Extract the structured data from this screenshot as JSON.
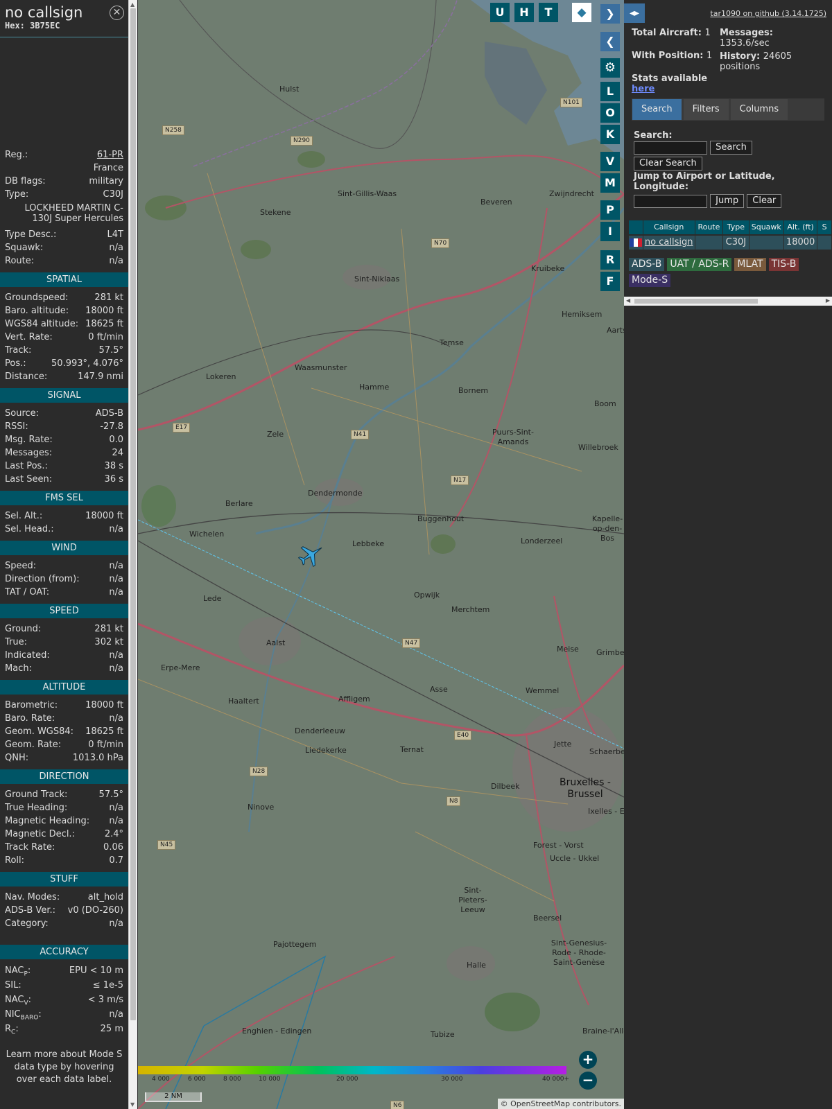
{
  "info": {
    "callsign": "no callsign",
    "hex": "Hex: 3B75EC",
    "reg_label": "Reg.:",
    "reg": "61-PR",
    "country": "France",
    "dbflags_label": "DB flags:",
    "dbflags": "military",
    "type_label": "Type:",
    "type": "C30J",
    "type_long": "LOCKHEED MARTIN C-130J Super Hercules",
    "typedesc_label": "Type Desc.:",
    "typedesc": "L4T",
    "squawk_label": "Squawk:",
    "squawk": "n/a",
    "route_label": "Route:",
    "route": "n/a",
    "sections": {
      "spatial": "SPATIAL",
      "signal": "SIGNAL",
      "fms": "FMS SEL",
      "wind": "WIND",
      "speed": "SPEED",
      "altitude": "ALTITUDE",
      "direction": "DIRECTION",
      "stuff": "STUFF",
      "accuracy": "ACCURACY"
    },
    "spatial": [
      {
        "k": "Groundspeed:",
        "v": "281 kt"
      },
      {
        "k": "Baro. altitude:",
        "v": "18000 ft"
      },
      {
        "k": "WGS84 altitude:",
        "v": "18625 ft"
      },
      {
        "k": "Vert. Rate:",
        "v": "0 ft/min"
      },
      {
        "k": "Track:",
        "v": "57.5°"
      },
      {
        "k": "Pos.:",
        "v": "50.993°, 4.076°"
      },
      {
        "k": "Distance:",
        "v": "147.9 nmi"
      }
    ],
    "signal": [
      {
        "k": "Source:",
        "v": "ADS-B"
      },
      {
        "k": "RSSI:",
        "v": "-27.8"
      },
      {
        "k": "Msg. Rate:",
        "v": "0.0"
      },
      {
        "k": "Messages:",
        "v": "24"
      },
      {
        "k": "Last Pos.:",
        "v": "38 s"
      },
      {
        "k": "Last Seen:",
        "v": "36 s"
      }
    ],
    "fms": [
      {
        "k": "Sel. Alt.:",
        "v": "18000 ft"
      },
      {
        "k": "Sel. Head.:",
        "v": "n/a"
      }
    ],
    "wind": [
      {
        "k": "Speed:",
        "v": "n/a"
      },
      {
        "k": "Direction (from):",
        "v": "n/a"
      },
      {
        "k": "TAT / OAT:",
        "v": "n/a"
      }
    ],
    "speed": [
      {
        "k": "Ground:",
        "v": "281 kt"
      },
      {
        "k": "True:",
        "v": "302 kt"
      },
      {
        "k": "Indicated:",
        "v": "n/a"
      },
      {
        "k": "Mach:",
        "v": "n/a"
      }
    ],
    "altitude": [
      {
        "k": "Barometric:",
        "v": "18000 ft"
      },
      {
        "k": "Baro. Rate:",
        "v": "n/a"
      },
      {
        "k": "Geom. WGS84:",
        "v": "18625 ft"
      },
      {
        "k": "Geom. Rate:",
        "v": "0 ft/min"
      },
      {
        "k": "QNH:",
        "v": "1013.0 hPa"
      }
    ],
    "direction": [
      {
        "k": "Ground Track:",
        "v": "57.5°"
      },
      {
        "k": "True Heading:",
        "v": "n/a"
      },
      {
        "k": "Magnetic Heading:",
        "v": "n/a"
      },
      {
        "k": "Magnetic Decl.:",
        "v": "2.4°"
      },
      {
        "k": "Track Rate:",
        "v": "0.06"
      },
      {
        "k": "Roll:",
        "v": "0.7"
      }
    ],
    "stuff": [
      {
        "k": "Nav. Modes:",
        "v": "alt_hold"
      },
      {
        "k": "ADS-B Ver.:",
        "v": "v0 (DO-260)"
      },
      {
        "k": "Category:",
        "v": "n/a"
      }
    ],
    "accuracy": {
      "nacp_k": "NAC",
      "nacp_sub": "P",
      "nacp_v": "EPU < 10 m",
      "sil_k": "SIL:",
      "sil_v": "≤ 1e-5",
      "nacv_k": "NAC",
      "nacv_sub": "V",
      "nacv_v": "< 3 m/s",
      "nic_k": "NIC",
      "nic_sub": "BARO",
      "nic_v": "n/a",
      "rc_k": "R",
      "rc_sub": "C",
      "rc_v": "25 m"
    },
    "learn_more": "Learn more about Mode S data type by hovering over each data label."
  },
  "map": {
    "buttons": [
      "U",
      "H",
      "T"
    ],
    "side_buttons": [
      "L",
      "O",
      "K",
      "V",
      "M",
      "P",
      "I",
      "R",
      "F"
    ],
    "places": [
      {
        "name": "Hulst"
      },
      {
        "name": "Stekene"
      },
      {
        "name": "Sint-Gillis-Waas"
      },
      {
        "name": "Beveren"
      },
      {
        "name": "Zwijndrecht"
      },
      {
        "name": "Kruibeke"
      },
      {
        "name": "Hemiksem"
      },
      {
        "name": "Sint-Niklaas"
      },
      {
        "name": "Temse"
      },
      {
        "name": "Lokeren"
      },
      {
        "name": "Waasmunster"
      },
      {
        "name": "Hamme"
      },
      {
        "name": "Bornem"
      },
      {
        "name": "Boom"
      },
      {
        "name": "Zele"
      },
      {
        "name": "Puurs-Sint-Amands"
      },
      {
        "name": "Willebroek"
      },
      {
        "name": "Berlare"
      },
      {
        "name": "Dendermonde"
      },
      {
        "name": "Buggenhout"
      },
      {
        "name": "Kapelle-op-den-Bos"
      },
      {
        "name": "Wichelen"
      },
      {
        "name": "Lebbeke"
      },
      {
        "name": "Londerzeel"
      },
      {
        "name": "Lede"
      },
      {
        "name": "Opwijk"
      },
      {
        "name": "Merchtem"
      },
      {
        "name": "Aalst"
      },
      {
        "name": "Meise"
      },
      {
        "name": "Grimberg"
      },
      {
        "name": "Erpe-Mere"
      },
      {
        "name": "Asse"
      },
      {
        "name": "Wemmel"
      },
      {
        "name": "Haaltert"
      },
      {
        "name": "Affligem"
      },
      {
        "name": "Denderleeuw"
      },
      {
        "name": "Ternat"
      },
      {
        "name": "Jette"
      },
      {
        "name": "Liedekerke"
      },
      {
        "name": "Dilbeek"
      },
      {
        "name": "Bruxelles - Brussel"
      },
      {
        "name": "Ninove"
      },
      {
        "name": "Forest - Vorst"
      },
      {
        "name": "Uccle - Ukkel"
      },
      {
        "name": "Sint-Pieters-Leeuw"
      },
      {
        "name": "Beersel"
      },
      {
        "name": "Pajottegem"
      },
      {
        "name": "Halle"
      },
      {
        "name": "Sint-Genesius-Rode - Rhode-Saint-Genèse"
      },
      {
        "name": "Enghien - Edingen"
      },
      {
        "name": "Tubize"
      },
      {
        "name": "Aarts"
      },
      {
        "name": "Schaerbe"
      },
      {
        "name": "Ixelles - Else"
      },
      {
        "name": "Braine-l'Alle"
      }
    ],
    "roads": [
      "N258",
      "N290",
      "N70",
      "N101",
      "N41",
      "N17",
      "E17",
      "N47",
      "E40",
      "N28",
      "N8",
      "N45",
      "N6"
    ],
    "colorbar_ticks": [
      "4 000",
      "6 000",
      "8 000",
      "10 000",
      "20 000",
      "30 000",
      "40 000+"
    ],
    "scale": "2 NM",
    "attribution_prefix": "© ",
    "attribution_link": "OpenStreetMap",
    "attribution_suffix": " contributors."
  },
  "side": {
    "github": "tar1090 on github (3.14.1725)",
    "total_label": "Total Aircraft:",
    "total": "1",
    "withpos_label": "With Position:",
    "withpos": "1",
    "stats_label": "Stats available",
    "stats_link": "here",
    "messages_label": "Messages:",
    "messages": "1353.6/sec",
    "history_label": "History:",
    "history": "24605 positions",
    "tabs": [
      "Search",
      "Filters",
      "Columns"
    ],
    "search_label": "Search:",
    "search_button": "Search",
    "clear_search_button": "Clear Search",
    "jump_label": "Jump to Airport or Latitude, Longitude:",
    "jump_button": "Jump",
    "clear_button": "Clear",
    "columns": [
      "Callsign",
      "Route",
      "Type",
      "Squawk",
      "Alt. (ft)",
      "S"
    ],
    "rows": [
      {
        "callsign": "no callsign",
        "route": "",
        "type": "C30J",
        "squawk": "",
        "alt": "18000"
      }
    ],
    "legend": [
      "ADS-B",
      "UAT / ADS-R",
      "MLAT",
      "TIS-B",
      "Mode-S"
    ],
    "colors": {
      "accent": "#005566",
      "adsb": "#2d4f5a",
      "uat": "#2e6b3e",
      "mlat": "#7a5a3c",
      "tisb": "#7a3434",
      "modes": "#3a2f63"
    }
  }
}
